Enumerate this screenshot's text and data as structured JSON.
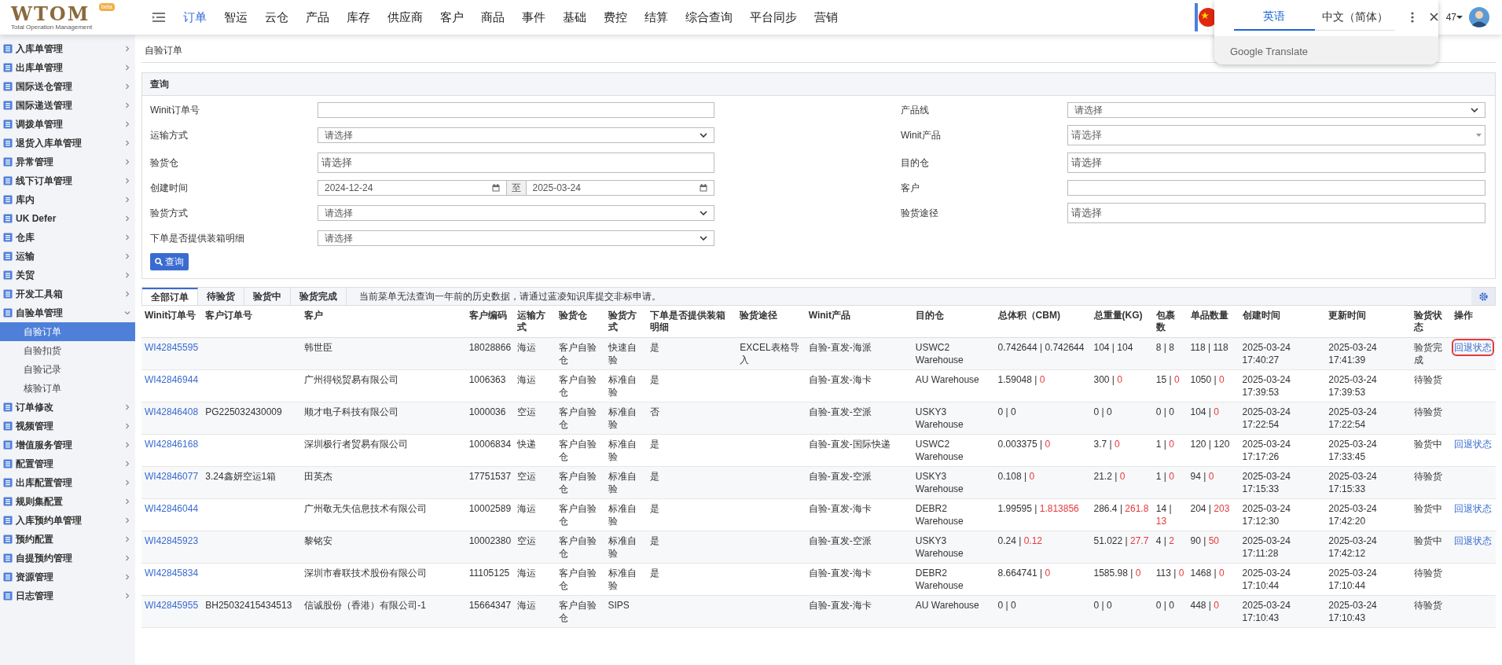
{
  "header": {
    "logo": {
      "text": "WTOM",
      "subtitle": "Total Operation Management",
      "badge": "beta"
    },
    "nav": [
      {
        "label": "订单",
        "selected": true
      },
      {
        "label": "智运",
        "selected": false
      },
      {
        "label": "云仓",
        "selected": false
      },
      {
        "label": "产品",
        "selected": false
      },
      {
        "label": "库存",
        "selected": false
      },
      {
        "label": "供应商",
        "selected": false
      },
      {
        "label": "客户",
        "selected": false
      },
      {
        "label": "商品",
        "selected": false
      },
      {
        "label": "事件",
        "selected": false
      },
      {
        "label": "基础",
        "selected": false
      },
      {
        "label": "费控",
        "selected": false
      },
      {
        "label": "结算",
        "selected": false
      },
      {
        "label": "综合查询",
        "selected": false
      },
      {
        "label": "平台同步",
        "selected": false
      },
      {
        "label": "营销",
        "selected": false
      }
    ],
    "user": "47",
    "translate_popup": {
      "tabs": [
        {
          "label": "英语",
          "selected": true
        },
        {
          "label": "中文（简体）",
          "selected": false
        }
      ],
      "footer": "Google Translate"
    }
  },
  "sidebar": {
    "items": [
      {
        "label": "入库单管理",
        "expanded": false
      },
      {
        "label": "出库单管理",
        "expanded": false
      },
      {
        "label": "国际送仓管理",
        "expanded": false
      },
      {
        "label": "国际递送管理",
        "expanded": false
      },
      {
        "label": "调拨单管理",
        "expanded": false
      },
      {
        "label": "退货入库单管理",
        "expanded": false
      },
      {
        "label": "异常管理",
        "expanded": false
      },
      {
        "label": "线下订单管理",
        "expanded": false
      },
      {
        "label": "库内",
        "expanded": false
      },
      {
        "label": "UK Defer",
        "expanded": false
      },
      {
        "label": "仓库",
        "expanded": false
      },
      {
        "label": "运输",
        "expanded": false
      },
      {
        "label": "关贸",
        "expanded": false
      },
      {
        "label": "开发工具箱",
        "expanded": false
      },
      {
        "label": "自验单管理",
        "expanded": true,
        "children": [
          {
            "label": "自验订单",
            "selected": true
          },
          {
            "label": "自验扣货",
            "selected": false
          },
          {
            "label": "自验记录",
            "selected": false
          },
          {
            "label": "核验订单",
            "selected": false
          }
        ]
      },
      {
        "label": "订单修改",
        "expanded": false
      },
      {
        "label": "视频管理",
        "expanded": false
      },
      {
        "label": "增值服务管理",
        "expanded": false
      },
      {
        "label": "配置管理",
        "expanded": false
      },
      {
        "label": "出库配置管理",
        "expanded": false
      },
      {
        "label": "规则集配置",
        "expanded": false
      },
      {
        "label": "入库预约单管理",
        "expanded": false
      },
      {
        "label": "预约配置",
        "expanded": false
      },
      {
        "label": "自提预约管理",
        "expanded": false
      },
      {
        "label": "资源管理",
        "expanded": false
      },
      {
        "label": "日志管理",
        "expanded": false
      }
    ]
  },
  "breadcrumb": "自验订单",
  "query": {
    "title": "查询",
    "button": "查询",
    "rows": [
      [
        {
          "label": "Winit订单号",
          "kind": "text"
        },
        {
          "label": "产品线",
          "kind": "select",
          "value": "请选择"
        }
      ],
      [
        {
          "label": "运输方式",
          "kind": "select",
          "value": "请选择"
        },
        {
          "label": "Winit产品",
          "kind": "combo",
          "placeholder": "请选择"
        }
      ],
      [
        {
          "label": "验货仓",
          "kind": "tags",
          "placeholder": "请选择"
        },
        {
          "label": "目的仓",
          "kind": "tags",
          "placeholder": "请选择"
        }
      ],
      [
        {
          "label": "创建时间",
          "kind": "date_range",
          "from": "2024-12-24",
          "separator": "至",
          "to": "2025-03-24"
        },
        {
          "label": "客户",
          "kind": "text"
        }
      ],
      [
        {
          "label": "验货方式",
          "kind": "select",
          "value": "请选择"
        },
        {
          "label": "验货途径",
          "kind": "tags",
          "placeholder": "请选择"
        }
      ],
      [
        {
          "label": "下单是否提供装箱明细",
          "kind": "select",
          "value": "请选择"
        }
      ]
    ]
  },
  "orders": {
    "tabs": [
      {
        "label": "全部订单",
        "selected": true
      },
      {
        "label": "待验货",
        "selected": false
      },
      {
        "label": "验货中",
        "selected": false
      },
      {
        "label": "验货完成",
        "selected": false
      }
    ],
    "notice": "当前菜单无法查询一年前的历史数据，请通过蓝凌知识库提交非标申请。",
    "columns": [
      "Winit订单号",
      "客户订单号",
      "客户",
      "客户编码",
      "运输方式",
      "验货仓",
      "验货方式",
      "下单是否提供装箱明细",
      "验货途径",
      "Winit产品",
      "目的仓",
      "总体积（CBM)",
      "总重量(KG)",
      "包裹数",
      "单品数量",
      "创建时间",
      "更新时间",
      "验货状态",
      "操作"
    ],
    "rows": [
      {
        "winit_no": "WI42845595",
        "customer": "韩世臣",
        "customer_code": "18028866",
        "transport": "海运",
        "warehouse": "客户自验仓",
        "method": "快速自验",
        "packing_detail": "是",
        "route": "EXCEL表格导入",
        "product": "自验-直发-海派",
        "destination": "USWC2 Warehouse",
        "volume": {
          "a": "0.742644",
          "sep": "|",
          "b": "0.742644",
          "mismatch": false
        },
        "weight": {
          "a": "104",
          "sep": "|",
          "b": "104",
          "mismatch": false
        },
        "packages": {
          "a": "8",
          "sep": "|",
          "b": "8",
          "mismatch": false
        },
        "items": {
          "a": "118",
          "sep": "|",
          "b": "118",
          "mismatch": false
        },
        "created": "2025-03-24 17:40:27",
        "updated": "2025-03-24 17:41:39",
        "status": "验货完成",
        "action": "回退状态",
        "action_highlighted": true
      },
      {
        "winit_no": "WI42846944",
        "customer": "广州得锐贸易有限公司",
        "customer_code": "1006363",
        "transport": "海运",
        "warehouse": "客户自验仓",
        "method": "标准自验",
        "packing_detail": "是",
        "product": "自验-直发-海卡",
        "destination": "AU Warehouse",
        "volume": {
          "a": "1.59048",
          "sep": "|",
          "b": "0",
          "mismatch": true
        },
        "weight": {
          "a": "300",
          "sep": "|",
          "b": "0",
          "mismatch": true
        },
        "packages": {
          "a": "15",
          "sep": "|",
          "b": "0",
          "mismatch": true
        },
        "items": {
          "a": "1050",
          "sep": "|",
          "b": "0",
          "mismatch": true
        },
        "created": "2025-03-24 17:39:53",
        "updated": "2025-03-24 17:39:53",
        "status": "待验货"
      },
      {
        "winit_no": "WI42846408",
        "customer_order_no": "PG225032430009",
        "customer": "顺才电子科技有限公司",
        "customer_code": "1000036",
        "transport": "空运",
        "warehouse": "客户自验仓",
        "method": "标准自验",
        "packing_detail": "否",
        "product": "自验-直发-空派",
        "destination": "USKY3 Warehouse",
        "volume": {
          "a": "0",
          "sep": "|",
          "b": "0",
          "mismatch": false
        },
        "weight": {
          "a": "0",
          "sep": "|",
          "b": "0",
          "mismatch": false
        },
        "packages": {
          "a": "0",
          "sep": "|",
          "b": "0",
          "mismatch": false
        },
        "items": {
          "a": "104",
          "sep": "|",
          "b": "0",
          "mismatch": true
        },
        "created": "2025-03-24 17:22:54",
        "updated": "2025-03-24 17:22:54",
        "status": "待验货"
      },
      {
        "winit_no": "WI42846168",
        "customer": "深圳极行者贸易有限公司",
        "customer_code": "10006834",
        "transport": "快递",
        "warehouse": "客户自验仓",
        "method": "标准自验",
        "packing_detail": "是",
        "product": "自验-直发-国际快递",
        "destination": "USWC2 Warehouse",
        "volume": {
          "a": "0.003375",
          "sep": "|",
          "b": "0",
          "mismatch": true
        },
        "weight": {
          "a": "3.7",
          "sep": "|",
          "b": "0",
          "mismatch": true
        },
        "packages": {
          "a": "1",
          "sep": "|",
          "b": "0",
          "mismatch": true
        },
        "items": {
          "a": "120",
          "sep": "|",
          "b": "120",
          "mismatch": false
        },
        "created": "2025-03-24 17:17:26",
        "updated": "2025-03-24 17:33:45",
        "status": "验货中",
        "action": "回退状态",
        "action_highlighted": false
      },
      {
        "winit_no": "WI42846077",
        "customer_order_no": "3.24鑫妍空运1箱",
        "customer": "田英杰",
        "customer_code": "17751537",
        "transport": "空运",
        "warehouse": "客户自验仓",
        "method": "标准自验",
        "packing_detail": "是",
        "product": "自验-直发-空派",
        "destination": "USKY3 Warehouse",
        "volume": {
          "a": "0.108",
          "sep": "|",
          "b": "0",
          "mismatch": true
        },
        "weight": {
          "a": "21.2",
          "sep": "|",
          "b": "0",
          "mismatch": true
        },
        "packages": {
          "a": "1",
          "sep": "|",
          "b": "0",
          "mismatch": true
        },
        "items": {
          "a": "94",
          "sep": "|",
          "b": "0",
          "mismatch": true
        },
        "created": "2025-03-24 17:15:33",
        "updated": "2025-03-24 17:15:33",
        "status": "待验货"
      },
      {
        "winit_no": "WI42846044",
        "customer": "广州敬无失信息技术有限公司",
        "customer_code": "10002589",
        "transport": "海运",
        "warehouse": "客户自验仓",
        "method": "标准自验",
        "packing_detail": "是",
        "product": "自验-直发-海卡",
        "destination": "DEBR2 Warehouse",
        "volume": {
          "a": "1.99595",
          "sep": "|",
          "b": "1.813856",
          "mismatch": true
        },
        "weight": {
          "a": "286.4",
          "sep": "|",
          "b": "261.8",
          "mismatch": true
        },
        "packages": {
          "a": "14",
          "sep": "|",
          "b": "13",
          "mismatch": true
        },
        "items": {
          "a": "204",
          "sep": "|",
          "b": "203",
          "mismatch": true
        },
        "created": "2025-03-24 17:12:30",
        "updated": "2025-03-24 17:42:20",
        "status": "验货中",
        "action": "回退状态",
        "action_highlighted": false
      },
      {
        "winit_no": "WI42845923",
        "customer": "黎铭安",
        "customer_code": "10002380",
        "transport": "空运",
        "warehouse": "客户自验仓",
        "method": "标准自验",
        "packing_detail": "是",
        "product": "自验-直发-空派",
        "destination": "USKY3 Warehouse",
        "volume": {
          "a": "0.24",
          "sep": "|",
          "b": "0.12",
          "mismatch": true
        },
        "weight": {
          "a": "51.022",
          "sep": "|",
          "b": "27.7",
          "mismatch": true
        },
        "packages": {
          "a": "4",
          "sep": "|",
          "b": "2",
          "mismatch": true
        },
        "items": {
          "a": "90",
          "sep": "|",
          "b": "50",
          "mismatch": true
        },
        "created": "2025-03-24 17:11:28",
        "updated": "2025-03-24 17:42:12",
        "status": "验货中",
        "action": "回退状态",
        "action_highlighted": false
      },
      {
        "winit_no": "WI42845834",
        "customer": "深圳市睿联技术股份有限公司",
        "customer_code": "11105125",
        "transport": "海运",
        "warehouse": "客户自验仓",
        "method": "标准自验",
        "packing_detail": "是",
        "product": "自验-直发-海卡",
        "destination": "DEBR2 Warehouse",
        "volume": {
          "a": "8.664741",
          "sep": "|",
          "b": "0",
          "mismatch": true
        },
        "weight": {
          "a": "1585.98",
          "sep": "|",
          "b": "0",
          "mismatch": true
        },
        "packages": {
          "a": "113",
          "sep": "|",
          "b": "0",
          "mismatch": true
        },
        "items": {
          "a": "1468",
          "sep": "|",
          "b": "0",
          "mismatch": true
        },
        "created": "2025-03-24 17:10:44",
        "updated": "2025-03-24 17:10:44",
        "status": "待验货"
      },
      {
        "winit_no": "WI42845955",
        "customer_order_no": "BH25032415434513",
        "customer": "信诚股份（香港）有限公司-1",
        "customer_code": "15664347",
        "transport": "海运",
        "warehouse": "客户自验仓",
        "method": "SIPS",
        "product": "自验-直发-海卡",
        "destination": "AU Warehouse",
        "volume": {
          "a": "0",
          "sep": "|",
          "b": "0",
          "mismatch": false
        },
        "weight": {
          "a": "0",
          "sep": "|",
          "b": "0",
          "mismatch": false
        },
        "packages": {
          "a": "0",
          "sep": "|",
          "b": "0",
          "mismatch": false
        },
        "items": {
          "a": "448",
          "sep": "|",
          "b": "0",
          "mismatch": true
        },
        "created": "2025-03-24 17:10:43",
        "updated": "2025-03-24 17:10:43",
        "status": "待验货"
      }
    ]
  }
}
